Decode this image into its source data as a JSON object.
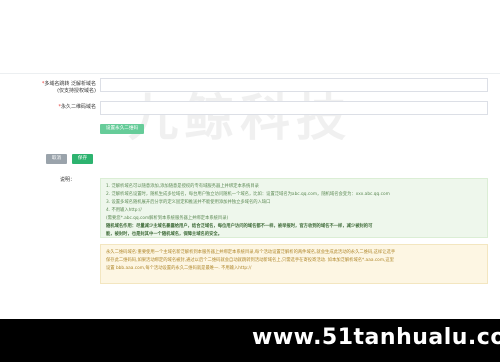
{
  "form": {
    "field1": {
      "required_mark": "*",
      "label_line1": "多域名跳转 泛解析域名",
      "label_line2": "(仅支持授权域名)",
      "value": ""
    },
    "field2": {
      "required_mark": "*",
      "label": "永久二维码域名",
      "value": ""
    },
    "set_button": "设置永久二维码",
    "cancel_button": "取消",
    "save_button": "保存",
    "desc_label": "说明："
  },
  "notes_green": {
    "lines": [
      "1. 泛解析域名可以随意添加,添加随意是授权的专有域服务器上并绑定本系统目录",
      "2. 泛解析域名设置时，随机生成多位域名，每台用户独立访问随机一个域名，比如：设置泛域名为abc.qq.com，随机域名会变为：xxx.abc.qq.com",
      "3. 设置多域名随机展开后分享的定义固定和推送并不能使用添加并独立多域名的入缺口",
      "4. 不用输入http://",
      "(需要您*.abc.qq.com解析到本系统服务器上并绑定本系统目录)"
    ],
    "bold_lines": [
      "随机域名作用：尽量减少主域名暴露给用户，结合泛域名，每位用户访问的域名都不一样，被举报时，官方收到的域名不一样，减少被封的可",
      "能，被封时，也是封其中一个随机域名，保障主域名的安全。"
    ]
  },
  "notes_yellow": {
    "lines": [
      "永久二维码域名:重要使用一个主域名新泛解析到本服务器上并绑定本系统目录,每个活动设置泛解析的两件域名,就会生成此活动的永久二维码,这样让选手",
      "保存此二维码码,如果活动绑定的域名被封,通过以后个二维码就会自动就跳转到活动新域名上,只需选手在寄投寄活动. 如本加泛解析域名*.aaa.com,这里",
      "设置 bbb.aaa.com,每个活动设置的永久二维码就是最唯一. 不用输入http://"
    ]
  },
  "watermark": "九鲸科技",
  "banner": {
    "text": "www.51tanhualu.com"
  }
}
